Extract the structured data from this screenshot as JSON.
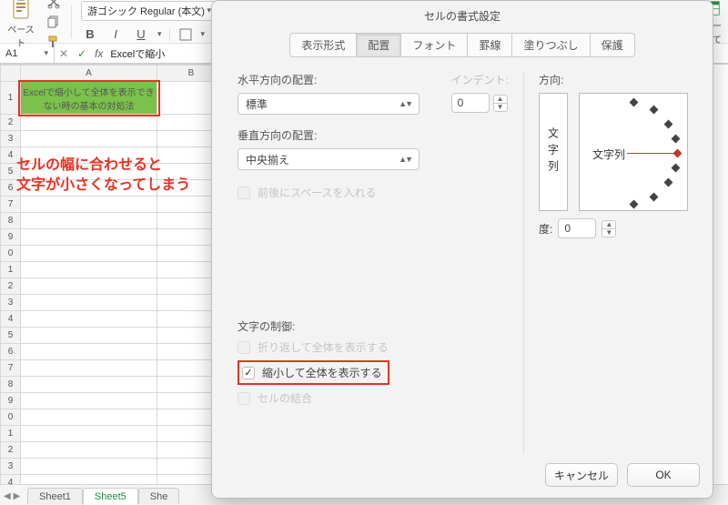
{
  "ribbon": {
    "paste_label": "ペースト",
    "font_name": "游ゴシック Regular (本文)",
    "bold": "B",
    "italic": "I",
    "underline": "U",
    "right_label": "テー\nして"
  },
  "formula_bar": {
    "cell_ref": "A1",
    "fx": "fx",
    "value": "Excelで縮小"
  },
  "grid": {
    "col_headers": [
      "A",
      "B"
    ],
    "row_headers": [
      "1",
      "2",
      "3",
      "4",
      "5",
      "6",
      "7",
      "8",
      "9",
      "0",
      "1",
      "2",
      "3",
      "4",
      "5",
      "6",
      "7",
      "8",
      "9",
      "0",
      "1",
      "2",
      "3",
      "4"
    ],
    "a1_text": "Excelで縮小して全体を表示できない時の基本の対処法"
  },
  "annotation": "セルの幅に合わせると\n文字が小さくなってしまう",
  "sheet_tabs": {
    "tabs": [
      "Sheet1",
      "Sheet5",
      "She"
    ],
    "active_index": 1
  },
  "dialog": {
    "title": "セルの書式設定",
    "tabs": [
      "表示形式",
      "配置",
      "フォント",
      "罫線",
      "塗りつぶし",
      "保護"
    ],
    "active_tab_index": 1,
    "h_align_label": "水平方向の配置:",
    "h_align_value": "標準",
    "indent_label": "インデント:",
    "indent_value": "0",
    "v_align_label": "垂直方向の配置:",
    "v_align_value": "中央揃え",
    "space_pad": "前後にスペースを入れる",
    "text_control_label": "文字の制御:",
    "wrap": "折り返して全体を表示する",
    "shrink": "縮小して全体を表示する",
    "merge": "セルの結合",
    "orient_label": "方向:",
    "orient_vert_text": "文字列",
    "orient_dial_text": "文字列",
    "degree_label": "度:",
    "degree_value": "0",
    "cancel": "キャンセル",
    "ok": "OK"
  }
}
